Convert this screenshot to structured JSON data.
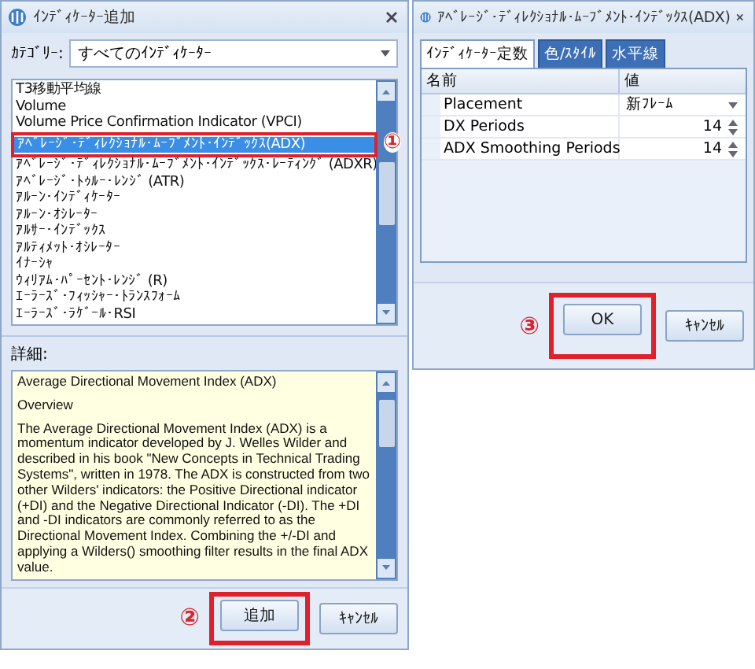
{
  "indicator_dialog": {
    "title": "ｲﾝﾃﾞｨｹｰﾀｰ追加",
    "category": {
      "label": "ｶﾃｺﾞﾘｰ:",
      "value": "すべてのｲﾝﾃﾞｨｹｰﾀｰ"
    },
    "indicators": [
      {
        "label": "T3移動平均線",
        "selected": false
      },
      {
        "label": "Volume",
        "selected": false
      },
      {
        "label": "Volume Price Confirmation Indicator (VPCI)",
        "selected": false
      },
      {
        "label": "ｱﾍﾞﾚｰｼﾞ･ﾃﾞｨﾚｸｼｮﾅﾙ･ﾑｰﾌﾞﾒﾝﾄ･ｲﾝﾃﾞｯｸｽ(ADX)",
        "selected": true,
        "callout": "①"
      },
      {
        "label": "ｱﾍﾞﾚｰｼﾞ･ﾃﾞｨﾚｸｼｮﾅﾙ･ﾑｰﾌﾞﾒﾝﾄ･ｲﾝﾃﾞｯｸｽ･ﾚｰﾃｨﾝｸﾞ (ADXR)",
        "selected": false
      },
      {
        "label": "ｱﾍﾞﾚｰｼﾞ･ﾄｩﾙｰ･ﾚﾝｼﾞ (ATR)",
        "selected": false
      },
      {
        "label": "ｱﾙｰﾝ･ｲﾝﾃﾞｨｹｰﾀｰ",
        "selected": false
      },
      {
        "label": "ｱﾙｰﾝ･ｵｼﾚｰﾀｰ",
        "selected": false
      },
      {
        "label": "ｱﾙｻｰ･ｲﾝﾃﾞｯｸｽ",
        "selected": false
      },
      {
        "label": "ｱﾙﾃｨﾒｯﾄ･ｵｼﾚｰﾀｰ",
        "selected": false
      },
      {
        "label": "ｲﾅｰｼｬ",
        "selected": false
      },
      {
        "label": "ｳｨﾘｱﾑ･ﾊﾟｰｾﾝﾄ･ﾚﾝｼﾞ (R)",
        "selected": false
      },
      {
        "label": "ｴｰﾗｰｽﾞ･ﾌｨｯｼｬｰ･ﾄﾗﾝｽﾌｫｰﾑ",
        "selected": false
      },
      {
        "label": "ｴｰﾗｰｽﾞ･ﾗｹﾞｰﾙ･RSI",
        "selected": false
      }
    ],
    "details": {
      "label": "詳細:",
      "paragraphs": [
        "Average Directional Movement Index (ADX)",
        "Overview",
        "The Average Directional Movement Index (ADX) is a momentum indicator developed by J. Welles Wilder and described in his book \"New Concepts in Technical Trading Systems\", written in 1978. The ADX is constructed from two other Wilders' indicators: the Positive Directional indicator (+DI) and the Negative Directional Indicator (-DI). The +DI and -DI indicators are commonly referred to as the Directional Movement Index. Combining the +/-DI and applying a Wilders() smoothing filter results in the final ADX value."
      ]
    },
    "buttons": [
      {
        "label": "追加",
        "callout": "②"
      },
      {
        "label": "ｷｬﾝｾﾙ"
      }
    ]
  },
  "properties_dialog": {
    "title": "ｱﾍﾞﾚｰｼﾞ･ﾃﾞｨﾚｸｼｮﾅﾙ･ﾑｰﾌﾞﾒﾝﾄ･ｲﾝﾃﾞｯｸｽ(ADX)",
    "tabs": [
      {
        "label": "ｲﾝﾃﾞｨｹｰﾀｰ定数",
        "selected": true
      },
      {
        "label": "色/ｽﾀｲﾙ",
        "selected": false
      },
      {
        "label": "水平線",
        "selected": false
      }
    ],
    "grid": {
      "columns": [
        "名前",
        "値"
      ],
      "rows": [
        {
          "name": "Placement",
          "value": "新ﾌﾚｰﾑ",
          "kind": "dropdown"
        },
        {
          "name": "DX Periods",
          "value": "14",
          "kind": "spinner"
        },
        {
          "name": "ADX Smoothing Periods",
          "value": "14",
          "kind": "spinner"
        }
      ]
    },
    "buttons": [
      {
        "label": "OK",
        "callout": "③"
      },
      {
        "label": "ｷｬﾝｾﾙ"
      }
    ]
  }
}
